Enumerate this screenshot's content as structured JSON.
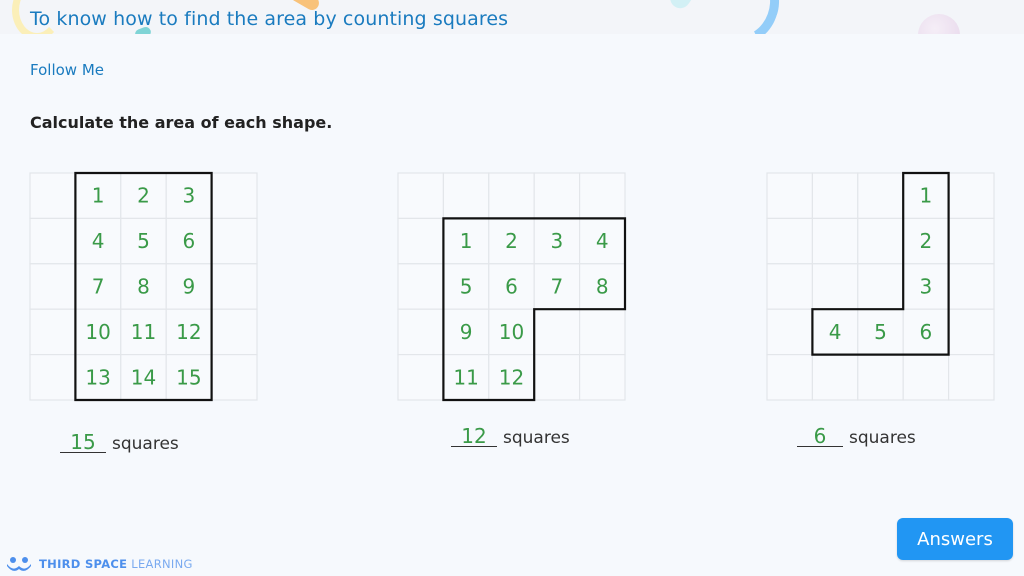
{
  "header": {
    "title": "To know how to find the area by counting squares"
  },
  "subtitle": "Follow Me",
  "instruction": "Calculate the area of each shape.",
  "colors": {
    "title": "#1a7bbf",
    "numbers": "#3a9a48",
    "grid_line": "#e3e6ea",
    "outline": "#111111",
    "button": "#2196f3"
  },
  "shapes": [
    {
      "grid": {
        "cols": 5,
        "rows": 5
      },
      "cells": [
        [
          1,
          0
        ],
        [
          2,
          0
        ],
        [
          3,
          0
        ],
        [
          1,
          1
        ],
        [
          2,
          1
        ],
        [
          3,
          1
        ],
        [
          1,
          2
        ],
        [
          2,
          2
        ],
        [
          3,
          2
        ],
        [
          1,
          3
        ],
        [
          2,
          3
        ],
        [
          3,
          3
        ],
        [
          1,
          4
        ],
        [
          2,
          4
        ],
        [
          3,
          4
        ]
      ],
      "labels": [
        "1",
        "2",
        "3",
        "4",
        "5",
        "6",
        "7",
        "8",
        "9",
        "10",
        "11",
        "12",
        "13",
        "14",
        "15"
      ],
      "outline": [
        [
          1,
          0
        ],
        [
          4,
          0
        ],
        [
          4,
          5
        ],
        [
          1,
          5
        ]
      ],
      "answer": "15",
      "unit": "squares"
    },
    {
      "grid": {
        "cols": 5,
        "rows": 5
      },
      "cells": [
        [
          1,
          1
        ],
        [
          2,
          1
        ],
        [
          3,
          1
        ],
        [
          4,
          1
        ],
        [
          1,
          2
        ],
        [
          2,
          2
        ],
        [
          3,
          2
        ],
        [
          4,
          2
        ],
        [
          1,
          3
        ],
        [
          2,
          3
        ],
        [
          1,
          4
        ],
        [
          2,
          4
        ]
      ],
      "labels": [
        "1",
        "2",
        "3",
        "4",
        "5",
        "6",
        "7",
        "8",
        "9",
        "10",
        "11",
        "12"
      ],
      "outline": [
        [
          1,
          1
        ],
        [
          5,
          1
        ],
        [
          5,
          3
        ],
        [
          3,
          3
        ],
        [
          3,
          5
        ],
        [
          1,
          5
        ]
      ],
      "answer": "12",
      "unit": "squares"
    },
    {
      "grid": {
        "cols": 5,
        "rows": 5
      },
      "cells": [
        [
          3,
          0
        ],
        [
          3,
          1
        ],
        [
          3,
          2
        ],
        [
          1,
          3
        ],
        [
          2,
          3
        ],
        [
          3,
          3
        ]
      ],
      "labels": [
        "1",
        "2",
        "3",
        "4",
        "5",
        "6"
      ],
      "outline": [
        [
          3,
          0
        ],
        [
          4,
          0
        ],
        [
          4,
          4
        ],
        [
          1,
          4
        ],
        [
          1,
          3
        ],
        [
          3,
          3
        ]
      ],
      "answer": "6",
      "unit": "squares"
    }
  ],
  "footer": {
    "logo_bold": "THIRD SPACE",
    "logo_light": "LEARNING",
    "answers_button": "Answers"
  }
}
